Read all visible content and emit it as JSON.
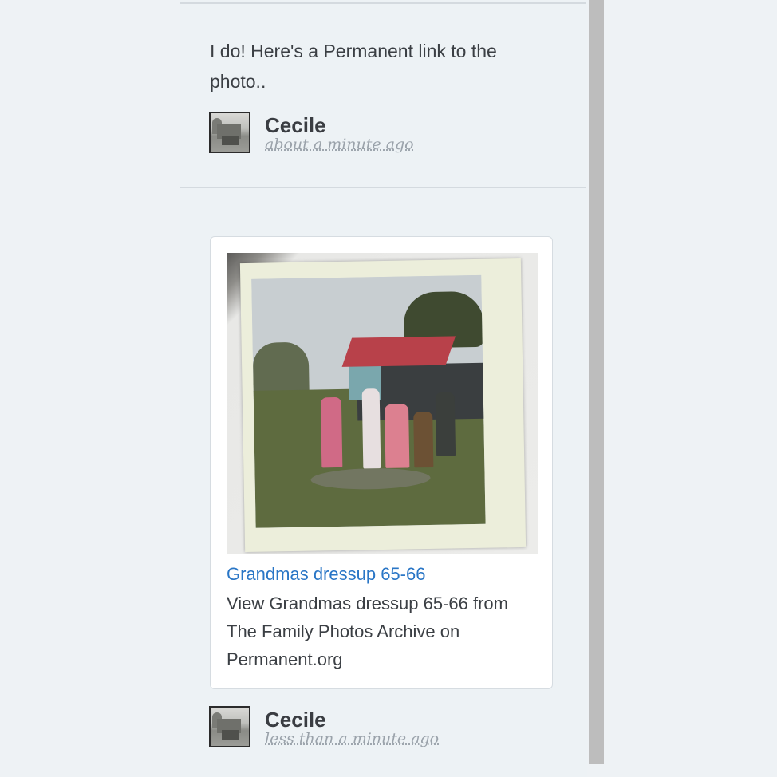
{
  "messages": [
    {
      "text": "I do! Here's a Permanent link to the photo..",
      "author": "Cecile",
      "timestamp": "about a minute ago"
    },
    {
      "card": {
        "title": "Grandmas dressup 65-66",
        "description": "View Grandmas dressup 65-66 from The Family Photos Archive on Permanent.org"
      },
      "author": "Cecile",
      "timestamp": "less than a minute ago"
    }
  ],
  "colors": {
    "link": "#2a76c6",
    "background": "#edf2f5",
    "text": "#3b3f44",
    "timestamp": "#9aa2aa",
    "scrollbar": "#bdbdbd"
  },
  "icons": {
    "avatar": "avatar-photo-icon"
  }
}
